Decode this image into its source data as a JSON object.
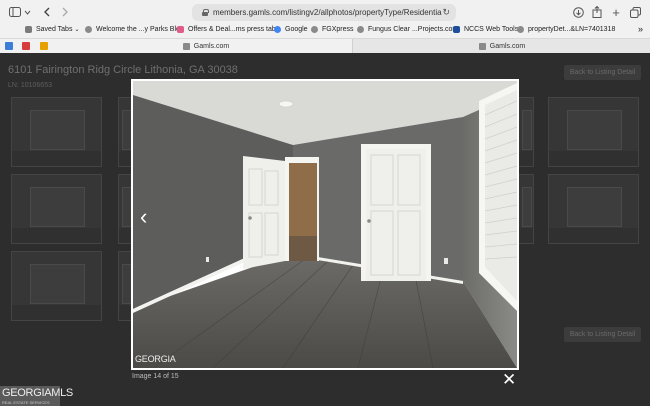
{
  "browser": {
    "saved_tabs_label": "Saved Tabs",
    "url": "members.gamls.com/listingv2/allphotos/propertyType/Residential%20Le...",
    "bookmarks": [
      {
        "label": "Saved Tabs",
        "icon": "folder-icon",
        "color": "#7a7a7a"
      },
      {
        "label": "Welcome the ...y Parks Blog",
        "icon": "globe-icon",
        "color": "#8a8a8a"
      },
      {
        "label": "Offers & Deal...ms press tab.",
        "icon": "tag-icon",
        "color": "#e05a8a"
      },
      {
        "label": "Google",
        "icon": "google-icon",
        "color": "#4285f4"
      },
      {
        "label": "FGXpress",
        "icon": "globe-icon",
        "color": "#8a8a8a"
      },
      {
        "label": "Fungus Clear ...Projects.com",
        "icon": "globe-icon",
        "color": "#8a8a8a"
      },
      {
        "label": "NCCS Web Tools",
        "icon": "nccs-icon",
        "color": "#1d4f9c"
      },
      {
        "label": "propertyDet...&LN=7401318",
        "icon": "globe-icon",
        "color": "#8a8a8a"
      }
    ],
    "tabs": [
      {
        "label": "Gamls.com",
        "active": false
      },
      {
        "label": "Gamls.com",
        "active": true
      }
    ]
  },
  "listing": {
    "address": "6101 Fairington Ridg Circle Lithonia, GA 30038",
    "ln": "LN: 10106653",
    "back_label": "Back to Listing Detail"
  },
  "viewer": {
    "counter": "Image 14 of 15",
    "watermark": "GEORGIA",
    "prev_icon": "chevron-left-icon",
    "close_icon": "close-icon"
  },
  "footer_logo": {
    "name": "GEORGIAMLS",
    "tagline": "REAL ESTATE SERVICES"
  }
}
